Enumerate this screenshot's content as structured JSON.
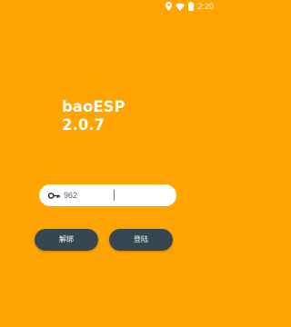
{
  "status_bar": {
    "time": "2:20",
    "icons": [
      "location-icon",
      "wifi-icon",
      "battery-icon"
    ]
  },
  "app": {
    "title_line1": "baoESP",
    "title_line2": "2.0.7"
  },
  "key_field": {
    "icon": "key-icon",
    "value": "962"
  },
  "buttons": {
    "unbind_label": "解绑",
    "login_label": "登陆"
  },
  "colors": {
    "background": "#FFA400",
    "button": "#37474F",
    "field": "#FFFFFF"
  }
}
